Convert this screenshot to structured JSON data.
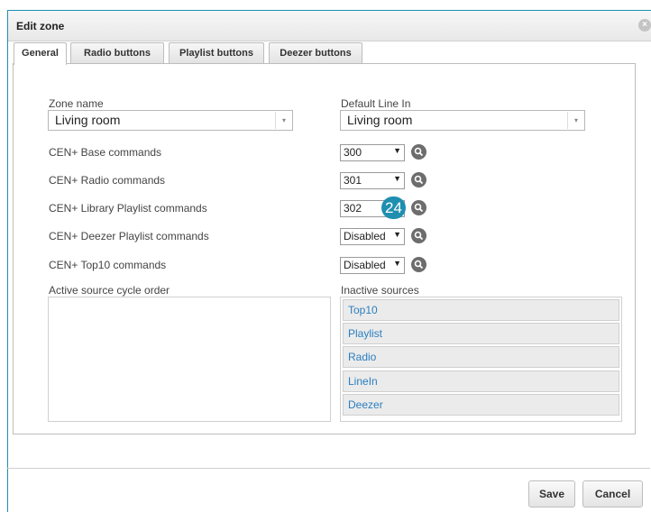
{
  "dialog": {
    "title": "Edit zone",
    "close_label": "×"
  },
  "tabs": [
    {
      "label": "General",
      "active": true
    },
    {
      "label": "Radio buttons",
      "active": false
    },
    {
      "label": "Playlist buttons",
      "active": false
    },
    {
      "label": "Deezer buttons",
      "active": false
    }
  ],
  "form": {
    "zone_name_label": "Zone name",
    "zone_name_value": "Living room",
    "default_line_in_label": "Default Line In",
    "default_line_in_value": "Living room",
    "rows": [
      {
        "label": "CEN+ Base commands",
        "value": "300"
      },
      {
        "label": "CEN+ Radio commands",
        "value": "301"
      },
      {
        "label": "CEN+ Library Playlist commands",
        "value": "302"
      },
      {
        "label": "CEN+ Deezer Playlist commands",
        "value": "Disabled"
      },
      {
        "label": "CEN+ Top10 commands",
        "value": "Disabled"
      }
    ],
    "active_sources_label": "Active source cycle order",
    "inactive_sources_label": "Inactive sources",
    "inactive_sources": [
      "Top10",
      "Playlist",
      "Radio",
      "LineIn",
      "Deezer"
    ]
  },
  "callout": {
    "number": "24"
  },
  "footer": {
    "save_label": "Save",
    "cancel_label": "Cancel"
  },
  "icons": {
    "dropdown_arrow": "▼",
    "combo_arrow": "▾",
    "search": "search-icon"
  },
  "colors": {
    "accent": "#1f8fb0",
    "link": "#2a7fc0"
  }
}
